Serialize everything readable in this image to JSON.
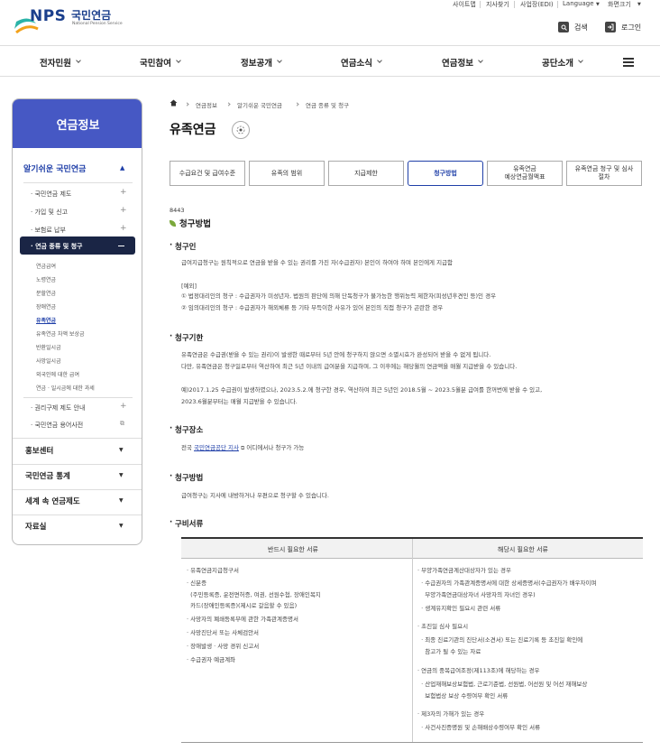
{
  "brand": {
    "name": "NPS",
    "name_ko": "국민연금",
    "tagline": "National Pension Service"
  },
  "utility": [
    "사이트맵",
    "지사찾기",
    "사업장(EDI)",
    "Language",
    "화면크기"
  ],
  "header_buttons": {
    "search": "검색",
    "login": "로그인"
  },
  "gnb": [
    "전자민원",
    "국민참여",
    "정보공개",
    "연금소식",
    "연금정보",
    "공단소개"
  ],
  "sidebar": {
    "title": "연금정보",
    "section": "알기쉬운 국민연금",
    "items": [
      "국민연금 제도",
      "가입 및 신고",
      "보험료 납부",
      "연금 종류 및 청구",
      "권리구제 제도 안내",
      "국민연금 용어사전"
    ],
    "subitems": [
      "연금급여",
      "노령연금",
      "분할연금",
      "장애연금",
      "유족연금",
      "유족연금 차액 보상금",
      "반환일시금",
      "사망일시금",
      "외국인에 대한 급여",
      "연금 · 일시금에 대한 과세"
    ],
    "groups": [
      "홍보센터",
      "국민연금 통계",
      "세계 속 연금제도",
      "자료실"
    ]
  },
  "breadcrumb": [
    "연금정보",
    "알기쉬운 국민연금",
    "연금 종류 및 청구"
  ],
  "page_title": "유족연금",
  "tabs": [
    "수급요건 및 급여수준",
    "유족의 범위",
    "지급제한",
    "청구방법",
    "유족연금\n예상연금월액표",
    "유족연금 청구 및 심사\n절차"
  ],
  "content": {
    "code": "8443",
    "section_title": "청구방법",
    "claimant": {
      "title": "청구인",
      "p1": "급여지급청구는 원칙적으로 연금을 받을 수 있는 권리를 가진 자(수급권자) 본인이 하여야 하며 본인에게 지급함",
      "example": "[예외]",
      "ex1": "① 법정대리인의 청구 : 수급권자가 미성년자, 법원의 판단에 의해 단독청구가 불가능한 행위능력 제한자(피성년후견인 등)인 경우",
      "ex2": "② 임의대리인의 청구 : 수급권자가 해외체류 등 기타 부득이한 사유가 있어 본인의 직접 청구가 곤란한 경우"
    },
    "period": {
      "title": "청구기한",
      "p1": "유족연금은 수급권(받을 수 있는 권리)이 발생한 때로부터 5년 안에 청구하지 않으면 소멸시효가 완성되어 받을 수 없게 됩니다.",
      "p2": "다만, 유족연금은 청구일로부터 역산하여 최근 5년 이내의 급여분을 지급하며, 그 이후에는 해당월의 연금액을 매월 지급받을 수 있습니다.",
      "p3": "예)2017.1.25 수급권이 발생하였으나, 2023.5.2.에 청구한 경우, 역산하여 최근 5년인 2018.5월 ~ 2023.5월분 급여를 한꺼번에 받을 수 있고,",
      "p4": "2023.6월분부터는 매월 지급받을 수 있습니다."
    },
    "place": {
      "title": "청구장소",
      "prefix": "전국",
      "link": "국민연금공단 지사",
      "suffix": "어디에서나 청구가 가능"
    },
    "method": {
      "title": "청구방법",
      "p1": "급여청구는 지사에 내방하거나 우편으로 청구할 수 있습니다."
    },
    "docs": {
      "title": "구비서류",
      "col1": "반드시 필요한 서류",
      "col2": "해당시 필요한 서류",
      "left": [
        "· 유족연금지급청구서",
        "· 신분증",
        "  (주민등록증, 운전면허증, 여권, 선원수첩, 장애인복지",
        "  카드(장애인등록증)(제시로 갈음할 수 있음)",
        "· 사망자의 폐쇄등록부에 관한 가족관계증명서",
        "· 사망진단서 또는 사체검안서",
        "· 장애발생 · 사망 경위 신고서",
        "· 수급권자 예금계좌"
      ],
      "right": [
        "· 부양가족연금계산대상자가 있는 경우",
        "  · 수급권자의 가족관계증명서에 대한 상세증명서(수급권자가 배우자이며",
        "    부양가족연금대상자녀 사망자의 자녀인 경우)",
        "  · 생계유지확인 필요시 관련 서류",
        "· 초진일 심사 필요시",
        "  · 최종 진료기관의 진단서(소견서) 또는 진료기록 등 초진일 확인에",
        "    참고가 될 수 있는 자료",
        "· 연금의 중복급여조정(제113조)에 해당하는 경우",
        "  · 산업재해보상보험법, 근로기준법, 선원법, 어선원 및 어선 재해보상",
        "    보험법상 보상 수령여부 확인 서류",
        "· 제3자의 가해가 있는 경우",
        "  · 사건사진증명원 및 손해배상수령여부 확인 서류"
      ]
    }
  },
  "colors": {
    "primary": "#1f3fa8",
    "sidebar_head": "#4658c4",
    "active": "#1a2545",
    "leaf": "#7aa83b"
  }
}
